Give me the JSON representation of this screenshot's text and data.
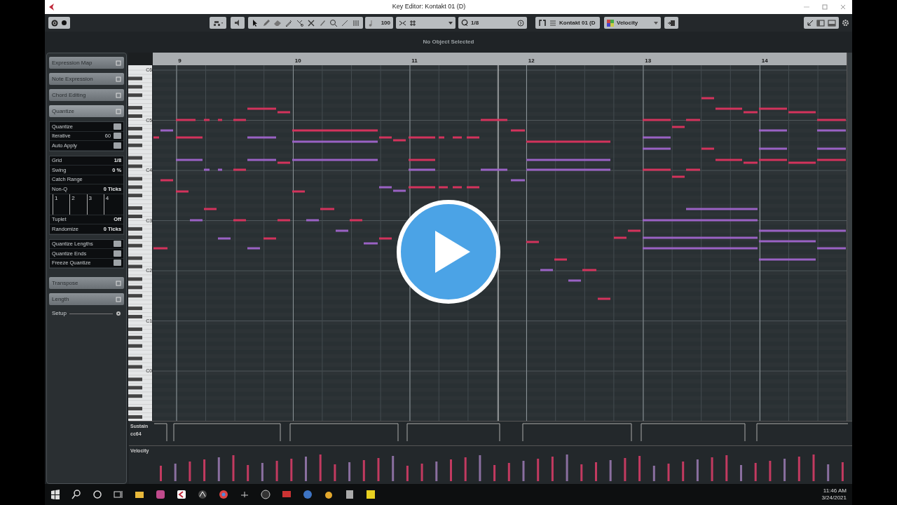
{
  "window": {
    "title": "Key Editor: Kontakt 01 (D)"
  },
  "toolbar": {
    "velocity": "100",
    "quantize": "1/8",
    "track": "Kontakt 01 (D",
    "controller": "Velocity"
  },
  "info_line": "No Object Selected",
  "inspector": {
    "sections": [
      {
        "label": "Expression Map",
        "expanded": false
      },
      {
        "label": "Note Expression",
        "expanded": false
      },
      {
        "label": "Chord Editing",
        "expanded": false
      },
      {
        "label": "Quantize",
        "expanded": true,
        "content": {
          "toggles": [
            {
              "label": "Quantize",
              "on": false
            },
            {
              "label": "Iterative",
              "value": "60",
              "on": false
            },
            {
              "label": "Auto Apply",
              "on": false
            }
          ],
          "settings": [
            {
              "label": "Grid",
              "value": "1/8"
            },
            {
              "label": "Swing",
              "value": "0 %"
            },
            {
              "label": "Catch Range"
            },
            {
              "label": "Non-Q",
              "value": "0 Ticks"
            }
          ],
          "grid_marks": [
            "1",
            "2",
            "3",
            "4"
          ],
          "settings_2": [
            {
              "label": "Tuplet",
              "value": "Off"
            },
            {
              "label": "Randomize",
              "value": "0 Ticks"
            }
          ],
          "options": [
            {
              "label": "Quantize Lengths",
              "on": false
            },
            {
              "label": "Quantize Ends",
              "on": false
            },
            {
              "label": "Freeze Quantize",
              "on": false
            }
          ]
        }
      },
      {
        "label": "Transpose",
        "expanded": false
      },
      {
        "label": "Length",
        "expanded": false
      }
    ],
    "setup": "Setup"
  },
  "ruler": {
    "bars": [
      "9",
      "10",
      "11",
      "12",
      "13",
      "14"
    ]
  },
  "keyboard": {
    "labels": [
      "C6",
      "C5",
      "C4",
      "C3",
      "C2",
      "C1",
      "C0"
    ]
  },
  "lanes": [
    {
      "kind": "sustain",
      "label": "Sustain",
      "sublabel": "cc64"
    },
    {
      "kind": "velocity",
      "label": "Velocity"
    }
  ],
  "taskbar": {
    "time": "11:46 AM",
    "date": "3/24/2021"
  }
}
